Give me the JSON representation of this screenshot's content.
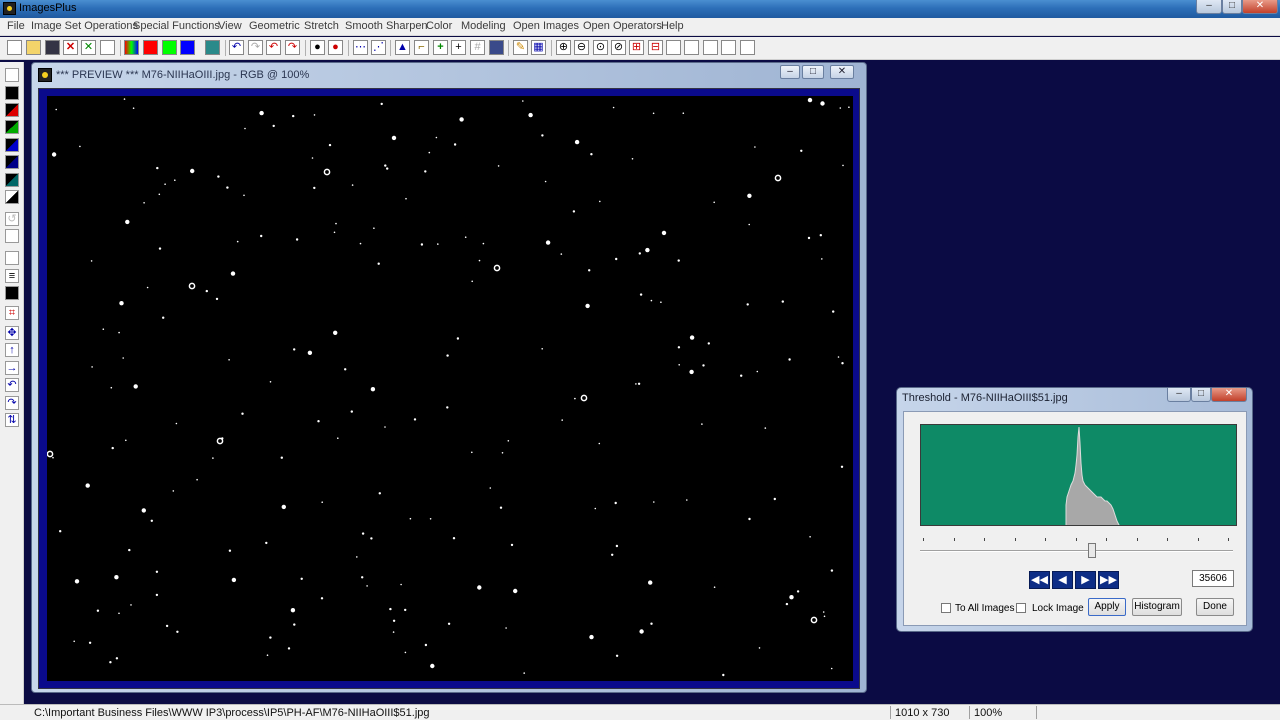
{
  "app": {
    "title": "ImagesPlus"
  },
  "menu": [
    "File",
    "Image Set Operations",
    "Special Functions",
    "View",
    "Geometric",
    "Stretch",
    "Smooth Sharpen",
    "Color",
    "Modeling",
    "Open Images",
    "Open Operators",
    "Help"
  ],
  "preview_window": {
    "title": "*** PREVIEW *** M76-NIIHaOIII.jpg - RGB @ 100%"
  },
  "threshold_dialog": {
    "title": "Threshold - M76-NIIHaOIII$51.jpg",
    "value": "35606",
    "slider_position": 0.55,
    "to_all_images_label": "To All Images",
    "lock_image_label": "Lock Image",
    "apply_label": "Apply",
    "histogram_label": "Histogram",
    "done_label": "Done",
    "nav_buttons": [
      "rewind-fast",
      "step-back",
      "step-forward",
      "forward-fast"
    ]
  },
  "statusbar": {
    "path": "C:\\Important Business Files\\WWW IP3\\process\\IP5\\PH-AF\\M76-NIIHaOIII$51.jpg",
    "dimensions": "1010 x 730",
    "zoom": "100%"
  },
  "colors": {
    "desktop": "#0b0b44",
    "histogram_bg": "#0e8a66",
    "canvas_frame": "#0a0a8c",
    "nav_button": "#0d2d86"
  }
}
